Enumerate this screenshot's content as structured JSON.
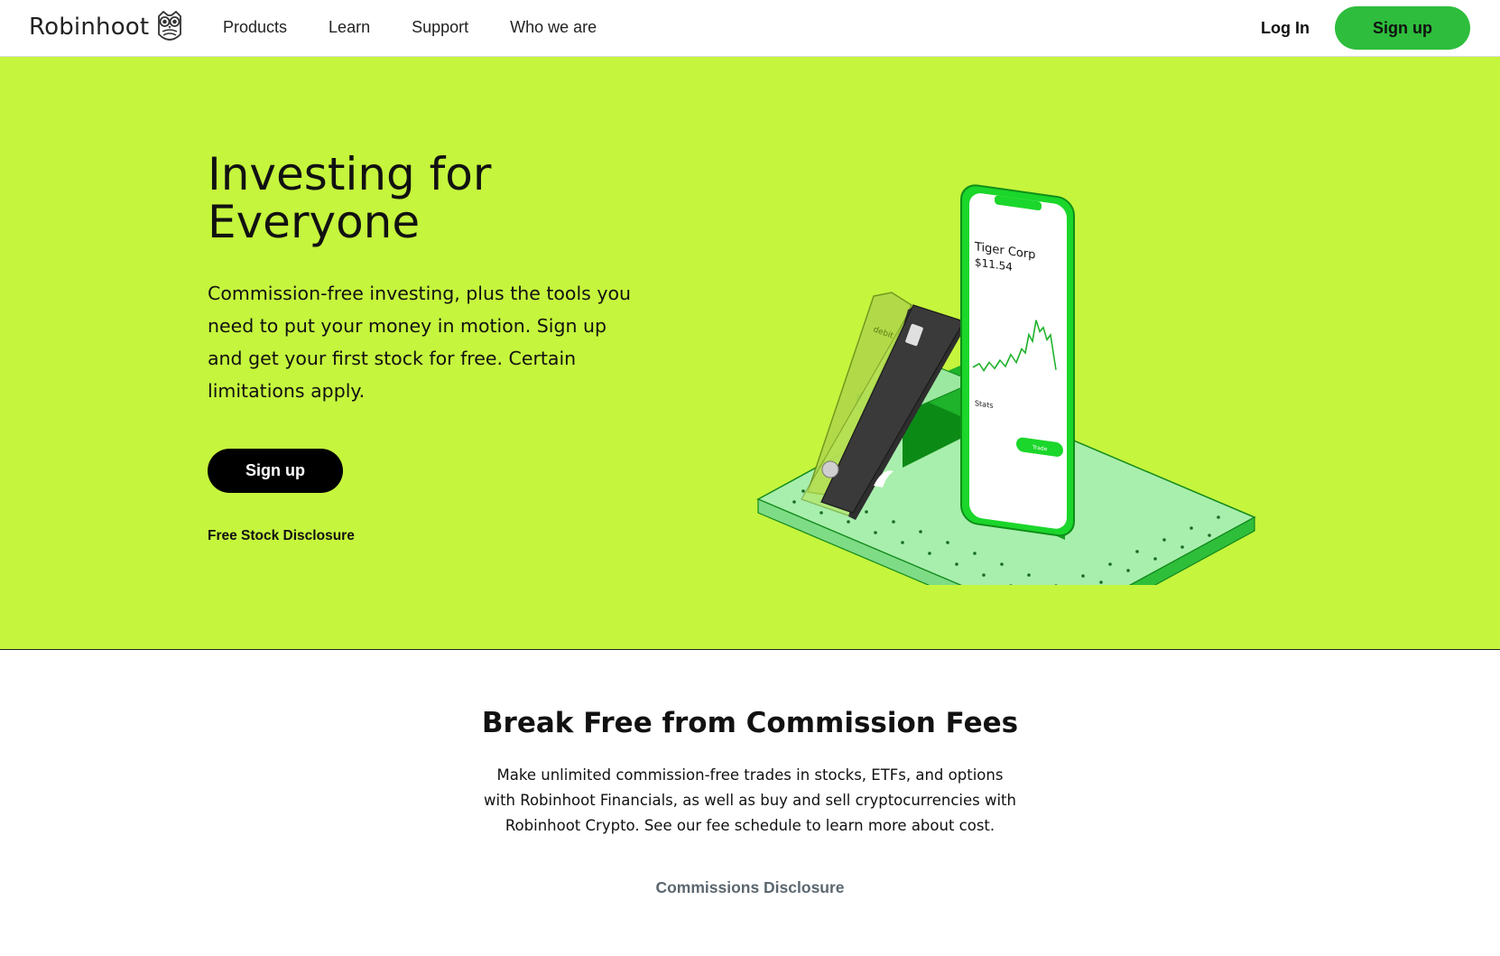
{
  "nav": {
    "brand": "Robinhoot",
    "links": [
      "Products",
      "Learn",
      "Support",
      "Who we are"
    ],
    "login_label": "Log In",
    "signup_label": "Sign up"
  },
  "hero": {
    "title_line1": "Investing for",
    "title_line2": "Everyone",
    "body": "Commission-free investing, plus the tools you need to put your money in motion. Sign up and get your first stock for free. Certain limitations apply.",
    "signup_label": "Sign up",
    "disclosure_label": "Free Stock Disclosure",
    "illustration": {
      "card_label": "debit",
      "phone_stock_name": "Tiger Corp",
      "phone_stock_price": "$11.54",
      "phone_section": "Stats",
      "phone_trade_button": "Trade"
    }
  },
  "fees": {
    "title": "Break Free from Commission Fees",
    "body": "Make unlimited commission-free trades in stocks, ETFs, and options with Robinhoot Financials, as well as buy and sell cryptocurrencies with Robinhoot Crypto. See our fee schedule to learn more about cost.",
    "disclosure_label": "Commissions Disclosure"
  },
  "colors": {
    "hero_bg": "#c5f53d",
    "accent_green": "#2ebd3c",
    "phone_green": "#1bd62b"
  }
}
